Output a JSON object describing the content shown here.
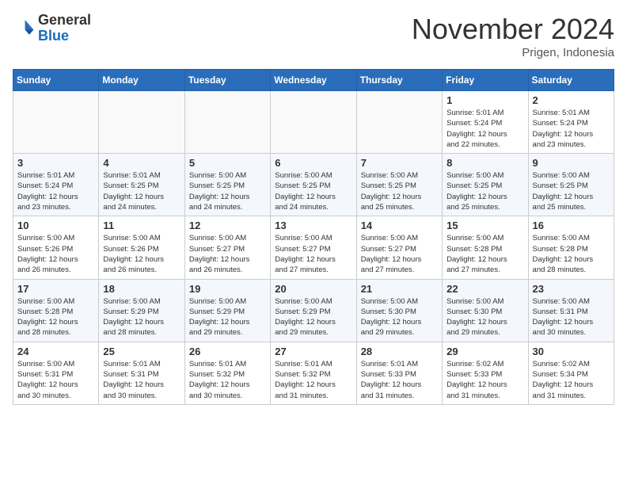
{
  "header": {
    "logo_line1": "General",
    "logo_line2": "Blue",
    "month_title": "November 2024",
    "location": "Prigen, Indonesia"
  },
  "days_of_week": [
    "Sunday",
    "Monday",
    "Tuesday",
    "Wednesday",
    "Thursday",
    "Friday",
    "Saturday"
  ],
  "weeks": [
    [
      {
        "day": "",
        "info": ""
      },
      {
        "day": "",
        "info": ""
      },
      {
        "day": "",
        "info": ""
      },
      {
        "day": "",
        "info": ""
      },
      {
        "day": "",
        "info": ""
      },
      {
        "day": "1",
        "info": "Sunrise: 5:01 AM\nSunset: 5:24 PM\nDaylight: 12 hours\nand 22 minutes."
      },
      {
        "day": "2",
        "info": "Sunrise: 5:01 AM\nSunset: 5:24 PM\nDaylight: 12 hours\nand 23 minutes."
      }
    ],
    [
      {
        "day": "3",
        "info": "Sunrise: 5:01 AM\nSunset: 5:24 PM\nDaylight: 12 hours\nand 23 minutes."
      },
      {
        "day": "4",
        "info": "Sunrise: 5:01 AM\nSunset: 5:25 PM\nDaylight: 12 hours\nand 24 minutes."
      },
      {
        "day": "5",
        "info": "Sunrise: 5:00 AM\nSunset: 5:25 PM\nDaylight: 12 hours\nand 24 minutes."
      },
      {
        "day": "6",
        "info": "Sunrise: 5:00 AM\nSunset: 5:25 PM\nDaylight: 12 hours\nand 24 minutes."
      },
      {
        "day": "7",
        "info": "Sunrise: 5:00 AM\nSunset: 5:25 PM\nDaylight: 12 hours\nand 25 minutes."
      },
      {
        "day": "8",
        "info": "Sunrise: 5:00 AM\nSunset: 5:25 PM\nDaylight: 12 hours\nand 25 minutes."
      },
      {
        "day": "9",
        "info": "Sunrise: 5:00 AM\nSunset: 5:25 PM\nDaylight: 12 hours\nand 25 minutes."
      }
    ],
    [
      {
        "day": "10",
        "info": "Sunrise: 5:00 AM\nSunset: 5:26 PM\nDaylight: 12 hours\nand 26 minutes."
      },
      {
        "day": "11",
        "info": "Sunrise: 5:00 AM\nSunset: 5:26 PM\nDaylight: 12 hours\nand 26 minutes."
      },
      {
        "day": "12",
        "info": "Sunrise: 5:00 AM\nSunset: 5:27 PM\nDaylight: 12 hours\nand 26 minutes."
      },
      {
        "day": "13",
        "info": "Sunrise: 5:00 AM\nSunset: 5:27 PM\nDaylight: 12 hours\nand 27 minutes."
      },
      {
        "day": "14",
        "info": "Sunrise: 5:00 AM\nSunset: 5:27 PM\nDaylight: 12 hours\nand 27 minutes."
      },
      {
        "day": "15",
        "info": "Sunrise: 5:00 AM\nSunset: 5:28 PM\nDaylight: 12 hours\nand 27 minutes."
      },
      {
        "day": "16",
        "info": "Sunrise: 5:00 AM\nSunset: 5:28 PM\nDaylight: 12 hours\nand 28 minutes."
      }
    ],
    [
      {
        "day": "17",
        "info": "Sunrise: 5:00 AM\nSunset: 5:28 PM\nDaylight: 12 hours\nand 28 minutes."
      },
      {
        "day": "18",
        "info": "Sunrise: 5:00 AM\nSunset: 5:29 PM\nDaylight: 12 hours\nand 28 minutes."
      },
      {
        "day": "19",
        "info": "Sunrise: 5:00 AM\nSunset: 5:29 PM\nDaylight: 12 hours\nand 29 minutes."
      },
      {
        "day": "20",
        "info": "Sunrise: 5:00 AM\nSunset: 5:29 PM\nDaylight: 12 hours\nand 29 minutes."
      },
      {
        "day": "21",
        "info": "Sunrise: 5:00 AM\nSunset: 5:30 PM\nDaylight: 12 hours\nand 29 minutes."
      },
      {
        "day": "22",
        "info": "Sunrise: 5:00 AM\nSunset: 5:30 PM\nDaylight: 12 hours\nand 29 minutes."
      },
      {
        "day": "23",
        "info": "Sunrise: 5:00 AM\nSunset: 5:31 PM\nDaylight: 12 hours\nand 30 minutes."
      }
    ],
    [
      {
        "day": "24",
        "info": "Sunrise: 5:00 AM\nSunset: 5:31 PM\nDaylight: 12 hours\nand 30 minutes."
      },
      {
        "day": "25",
        "info": "Sunrise: 5:01 AM\nSunset: 5:31 PM\nDaylight: 12 hours\nand 30 minutes."
      },
      {
        "day": "26",
        "info": "Sunrise: 5:01 AM\nSunset: 5:32 PM\nDaylight: 12 hours\nand 30 minutes."
      },
      {
        "day": "27",
        "info": "Sunrise: 5:01 AM\nSunset: 5:32 PM\nDaylight: 12 hours\nand 31 minutes."
      },
      {
        "day": "28",
        "info": "Sunrise: 5:01 AM\nSunset: 5:33 PM\nDaylight: 12 hours\nand 31 minutes."
      },
      {
        "day": "29",
        "info": "Sunrise: 5:02 AM\nSunset: 5:33 PM\nDaylight: 12 hours\nand 31 minutes."
      },
      {
        "day": "30",
        "info": "Sunrise: 5:02 AM\nSunset: 5:34 PM\nDaylight: 12 hours\nand 31 minutes."
      }
    ]
  ]
}
